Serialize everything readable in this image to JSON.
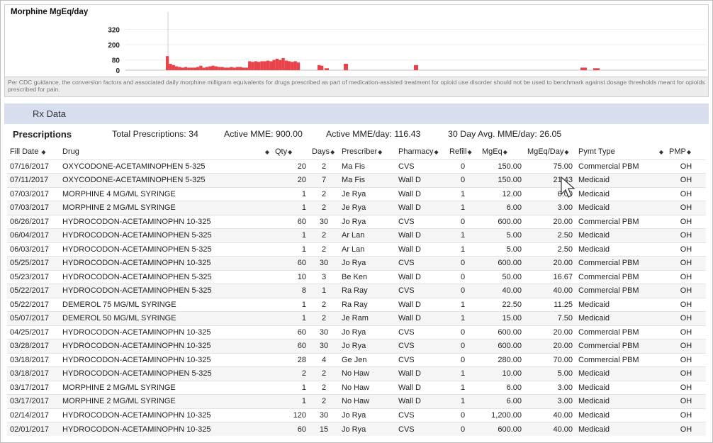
{
  "chart": {
    "title": "Morphine MgEq/day",
    "y_ticks": [
      "320",
      "200",
      "80",
      "0"
    ],
    "bar_color": "#e8424b"
  },
  "chart_data": {
    "type": "bar",
    "title": "Morphine MgEq/day",
    "ylim": [
      0,
      400
    ],
    "y_ticks": [
      0,
      80,
      200,
      320
    ],
    "values": [
      110,
      50,
      40,
      30,
      25,
      20,
      25,
      20,
      20,
      20,
      25,
      35,
      20,
      25,
      30,
      35,
      30,
      25,
      25,
      20,
      20,
      25,
      20,
      25,
      25,
      20,
      20,
      70,
      65,
      70,
      65,
      70,
      70,
      75,
      70,
      80,
      90,
      80,
      95,
      75,
      70,
      65,
      70,
      60,
      40,
      35,
      15,
      50,
      40,
      20,
      15
    ]
  },
  "note": "Per CDC guidance, the conversion factors and associated daily morphine milligram equivalents for drugs prescribed as part of medication-assisted treatment for opioid use disorder should not be used to benchmark against dosage thresholds meant for opioids prescribed for pain.",
  "rx_bar_label": "Rx Data",
  "summary": {
    "heading": "Prescriptions",
    "total": "Total Prescriptions: 34",
    "active_mme": "Active MME: 900.00",
    "active_mme_day": "Active MME/day: 116.43",
    "avg_mme_day": "30 Day Avg. MME/day: 26.05"
  },
  "columns": [
    "Fill Date",
    "Drug",
    "Qty",
    "Days",
    "Prescriber",
    "Pharmacy",
    "Refill",
    "MgEq",
    "MgEq/Day",
    "Pymt Type",
    "PMP"
  ],
  "rows": [
    [
      "07/16/2017",
      "OXYCODONE-ACETAMINOPHEN 5-325",
      "20",
      "2",
      "Ma Fis",
      "CVS",
      "0",
      "150.00",
      "75.00",
      "Commercial PBM",
      "OH"
    ],
    [
      "07/11/2017",
      "OXYCODONE-ACETAMINOPHEN 5-325",
      "20",
      "7",
      "Ma Fis",
      "Wall D",
      "0",
      "150.00",
      "21.43",
      "Medicaid",
      "OH"
    ],
    [
      "07/03/2017",
      "MORPHINE 4 MG/ML SYRINGE",
      "1",
      "2",
      "Je Rya",
      "Wall D",
      "1",
      "12.00",
      "6.00",
      "Medicaid",
      "OH"
    ],
    [
      "07/03/2017",
      "MORPHINE 2 MG/ML SYRINGE",
      "1",
      "2",
      "Je Rya",
      "Wall D",
      "1",
      "6.00",
      "3.00",
      "Medicaid",
      "OH"
    ],
    [
      "06/26/2017",
      "HYDROCODON-ACETAMINOPHN 10-325",
      "60",
      "30",
      "Jo Rya",
      "CVS",
      "0",
      "600.00",
      "20.00",
      "Commercial PBM",
      "OH"
    ],
    [
      "06/04/2017",
      "HYDROCODON-ACETAMINOPHEN 5-325",
      "1",
      "2",
      "Ar Lan",
      "Wall D",
      "1",
      "5.00",
      "2.50",
      "Medicaid",
      "OH"
    ],
    [
      "06/03/2017",
      "HYDROCODON-ACETAMINOPHEN 5-325",
      "1",
      "2",
      "Ar Lan",
      "Wall D",
      "1",
      "5.00",
      "2.50",
      "Medicaid",
      "OH"
    ],
    [
      "05/25/2017",
      "HYDROCODON-ACETAMINOPHN 10-325",
      "60",
      "30",
      "Jo Rya",
      "CVS",
      "0",
      "600.00",
      "20.00",
      "Commercial PBM",
      "OH"
    ],
    [
      "05/23/2017",
      "HYDROCODON-ACETAMINOPHEN 5-325",
      "10",
      "3",
      "Be Ken",
      "Wall D",
      "0",
      "50.00",
      "16.67",
      "Commercial PBM",
      "OH"
    ],
    [
      "05/22/2017",
      "HYDROCODON-ACETAMINOPHEN 5-325",
      "8",
      "1",
      "Ra Ray",
      "CVS",
      "0",
      "40.00",
      "40.00",
      "Commercial PBM",
      "OH"
    ],
    [
      "05/22/2017",
      "DEMEROL 75 MG/ML SYRINGE",
      "1",
      "2",
      "Ra Ray",
      "Wall D",
      "1",
      "22.50",
      "11.25",
      "Medicaid",
      "OH"
    ],
    [
      "05/07/2017",
      "DEMEROL 50 MG/ML SYRINGE",
      "1",
      "2",
      "Je Ram",
      "Wall D",
      "1",
      "15.00",
      "7.50",
      "Medicaid",
      "OH"
    ],
    [
      "04/25/2017",
      "HYDROCODON-ACETAMINOPHN 10-325",
      "60",
      "30",
      "Jo Rya",
      "CVS",
      "0",
      "600.00",
      "20.00",
      "Commercial PBM",
      "OH"
    ],
    [
      "03/28/2017",
      "HYDROCODON-ACETAMINOPHN 10-325",
      "60",
      "30",
      "Jo Rya",
      "CVS",
      "0",
      "600.00",
      "20.00",
      "Commercial PBM",
      "OH"
    ],
    [
      "03/18/2017",
      "HYDROCODON-ACETAMINOPHN 10-325",
      "28",
      "4",
      "Ge Jen",
      "CVS",
      "0",
      "280.00",
      "70.00",
      "Commercial PBM",
      "OH"
    ],
    [
      "03/18/2017",
      "HYDROCODON-ACETAMINOPHEN 5-325",
      "2",
      "2",
      "No Haw",
      "Wall D",
      "1",
      "10.00",
      "5.00",
      "Medicaid",
      "OH"
    ],
    [
      "03/17/2017",
      "MORPHINE 2 MG/ML SYRINGE",
      "1",
      "2",
      "No Haw",
      "Wall D",
      "1",
      "6.00",
      "3.00",
      "Medicaid",
      "OH"
    ],
    [
      "03/17/2017",
      "MORPHINE 2 MG/ML SYRINGE",
      "1",
      "2",
      "No Haw",
      "Wall D",
      "1",
      "6.00",
      "3.00",
      "Medicaid",
      "OH"
    ],
    [
      "02/14/2017",
      "HYDROCODON-ACETAMINOPHN 10-325",
      "120",
      "30",
      "Jo Rya",
      "CVS",
      "0",
      "1,200.00",
      "40.00",
      "Medicaid",
      "OH"
    ],
    [
      "02/01/2017",
      "HYDROCODON-ACETAMINOPHN 10-325",
      "60",
      "15",
      "Jo Rya",
      "CVS",
      "0",
      "600.00",
      "40.00",
      "Medicaid",
      "OH"
    ]
  ]
}
